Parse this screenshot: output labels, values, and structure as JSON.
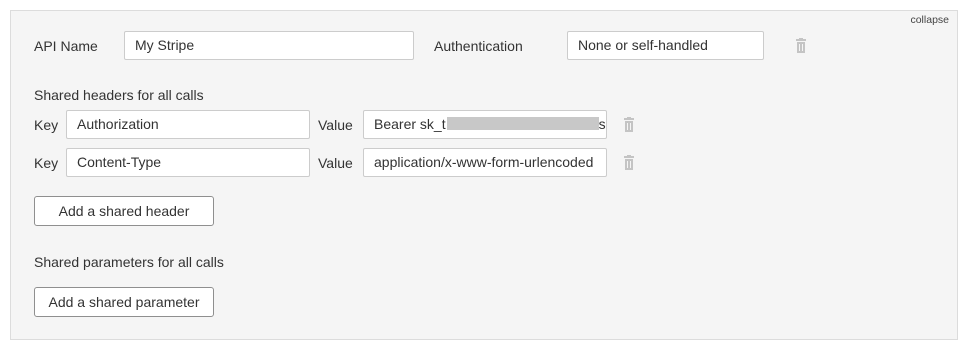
{
  "collapse_label": "collapse",
  "api": {
    "name_label": "API Name",
    "name_value": "My Stripe",
    "auth_label": "Authentication",
    "auth_value": "None or self-handled"
  },
  "shared_headers": {
    "title": "Shared headers for all calls",
    "rows": [
      {
        "key_label": "Key",
        "key_value": "Authorization",
        "value_label": "Value",
        "value_visible": "Bearer sk_t",
        "value_tail": "s",
        "value_redacted": true
      },
      {
        "key_label": "Key",
        "key_value": "Content-Type",
        "value_label": "Value",
        "value_visible": "application/x-www-form-urlencoded",
        "value_tail": "",
        "value_redacted": false
      }
    ],
    "add_button": "Add a shared header"
  },
  "shared_parameters": {
    "title": "Shared parameters for all calls",
    "add_button": "Add a shared parameter"
  },
  "icons": {
    "delete": "trash-icon"
  },
  "colors": {
    "panel_bg": "#f5f5f5",
    "border": "#dcdcdc",
    "icon": "#c4c4c4"
  }
}
